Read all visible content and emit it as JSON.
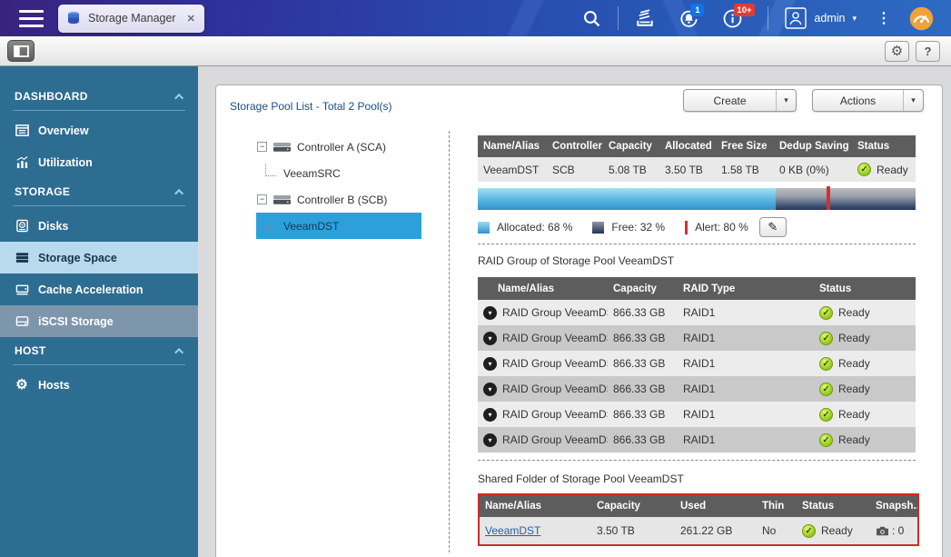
{
  "top_bar": {
    "tab_label": "Storage Manager",
    "user": "admin",
    "notification_badge": "1",
    "alert_badge": "10+"
  },
  "sidebar": {
    "sections": [
      {
        "label": "DASHBOARD",
        "items": [
          {
            "label": "Overview"
          },
          {
            "label": "Utilization"
          }
        ]
      },
      {
        "label": "STORAGE",
        "items": [
          {
            "label": "Disks"
          },
          {
            "label": "Storage Space"
          },
          {
            "label": "Cache Acceleration"
          },
          {
            "label": "iSCSI Storage"
          }
        ]
      },
      {
        "label": "HOST",
        "items": [
          {
            "label": "Hosts"
          }
        ]
      }
    ]
  },
  "main": {
    "title": "Storage Pool List - Total 2 Pool(s)",
    "create_label": "Create",
    "actions_label": "Actions",
    "tree": {
      "nodes": [
        {
          "label": "Controller A (SCA)",
          "children": [
            {
              "label": "VeeamSRC"
            }
          ]
        },
        {
          "label": "Controller B (SCB)",
          "children": [
            {
              "label": "VeeamDST"
            }
          ]
        }
      ]
    },
    "pool_table": {
      "headers": [
        "Name/Alias",
        "Controller",
        "Capacity",
        "Allocated",
        "Free Size",
        "Dedup Saving",
        "Status"
      ],
      "rows": [
        {
          "name": "VeeamDST",
          "controller": "SCB",
          "capacity": "5.08 TB",
          "allocated": "3.50 TB",
          "free": "1.58 TB",
          "dedup": "0 KB (0%)",
          "status": "Ready"
        }
      ]
    },
    "capacity": {
      "allocated_pct": 68,
      "free_pct": 32,
      "alert_pct": 80,
      "allocated_label": "Allocated: 68 %",
      "free_label": "Free: 32 %",
      "alert_label": "Alert: 80 %"
    },
    "raid_table": {
      "title": "RAID Group of Storage Pool VeeamDST",
      "headers": [
        "Name/Alias",
        "Capacity",
        "RAID Type",
        "Status"
      ],
      "rows": [
        {
          "name": "RAID Group VeeamDST...",
          "capacity": "866.33 GB",
          "type": "RAID1",
          "status": "Ready"
        },
        {
          "name": "RAID Group VeeamDST...",
          "capacity": "866.33 GB",
          "type": "RAID1",
          "status": "Ready"
        },
        {
          "name": "RAID Group VeeamDST...",
          "capacity": "866.33 GB",
          "type": "RAID1",
          "status": "Ready"
        },
        {
          "name": "RAID Group VeeamDST...",
          "capacity": "866.33 GB",
          "type": "RAID1",
          "status": "Ready"
        },
        {
          "name": "RAID Group VeeamDST...",
          "capacity": "866.33 GB",
          "type": "RAID1",
          "status": "Ready"
        },
        {
          "name": "RAID Group VeeamDST...",
          "capacity": "866.33 GB",
          "type": "RAID1",
          "status": "Ready"
        }
      ]
    },
    "shared_table": {
      "title": "Shared Folder of Storage Pool VeeamDST",
      "headers": [
        "Name/Alias",
        "Capacity",
        "Used",
        "Thin",
        "Status",
        "Snapsh..."
      ],
      "rows": [
        {
          "name": "VeeamDST",
          "capacity": "3.50 TB",
          "used": "261.22 GB",
          "thin": "No",
          "status": "Ready",
          "snapshots": ": 0"
        }
      ]
    }
  },
  "icons": {
    "check": "✓",
    "close": "✕",
    "caret_down": "▾",
    "kebab": "⋮",
    "help": "?",
    "gear": "⚙",
    "pencil": "✎",
    "minus": "−"
  },
  "colors": {
    "topbar_left": "#39237f",
    "topbar_right": "#2e6ac2",
    "sidebar": "#2e6d92",
    "sidebar_selected": "#b9d9ec",
    "tree_selected": "#2da0dc",
    "table_header": "#5d5d5d",
    "allocated_blue": "#2e93ca",
    "free_navy": "#23345a",
    "alert_red": "#d3302e",
    "status_green": "#7cb400",
    "highlight_border": "#cf2b24"
  }
}
